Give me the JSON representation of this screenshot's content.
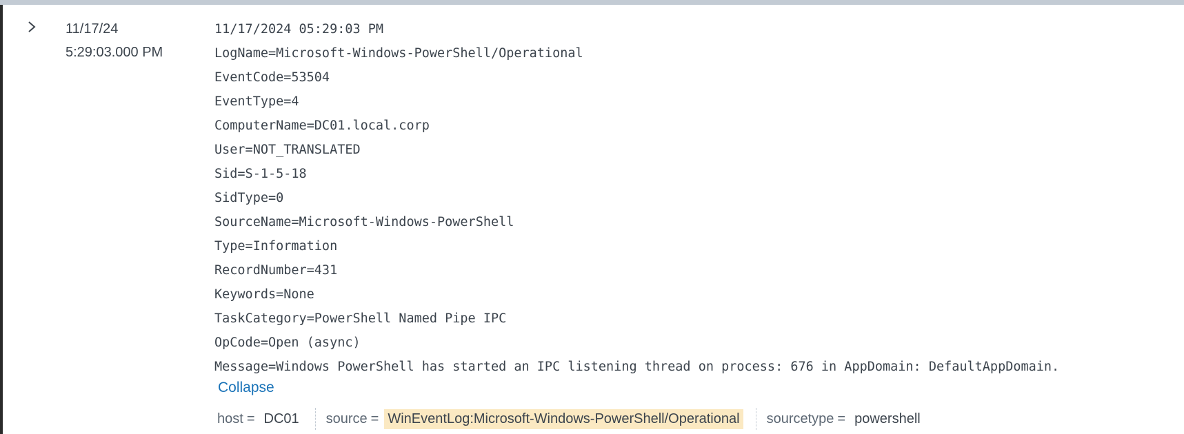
{
  "event": {
    "time": {
      "date": "11/17/24",
      "clock": "5:29:03.000 PM"
    },
    "raw_lines": [
      "11/17/2024 05:29:03 PM",
      "LogName=Microsoft-Windows-PowerShell/Operational",
      "EventCode=53504",
      "EventType=4",
      "ComputerName=DC01.local.corp",
      "User=NOT_TRANSLATED",
      "Sid=S-1-5-18",
      "SidType=0",
      "SourceName=Microsoft-Windows-PowerShell",
      "Type=Information",
      "RecordNumber=431",
      "Keywords=None",
      "TaskCategory=PowerShell Named Pipe IPC",
      "OpCode=Open (async)",
      "Message=Windows PowerShell has started an IPC listening thread on process: 676 in AppDomain: DefaultAppDomain."
    ],
    "collapse_label": "Collapse",
    "fields": [
      {
        "key": "host",
        "eq": "=",
        "value": "DC01",
        "highlighted": false
      },
      {
        "key": "source",
        "eq": "=",
        "value": "WinEventLog:Microsoft-Windows-PowerShell/Operational",
        "highlighted": true
      },
      {
        "key": "sourcetype",
        "eq": "=",
        "value": "powershell",
        "highlighted": false
      }
    ]
  },
  "icons": {
    "expand": "chevron-right-icon"
  },
  "colors": {
    "highlight": "#fbe9c2",
    "link": "#1a73b8",
    "text": "#3c444d"
  }
}
